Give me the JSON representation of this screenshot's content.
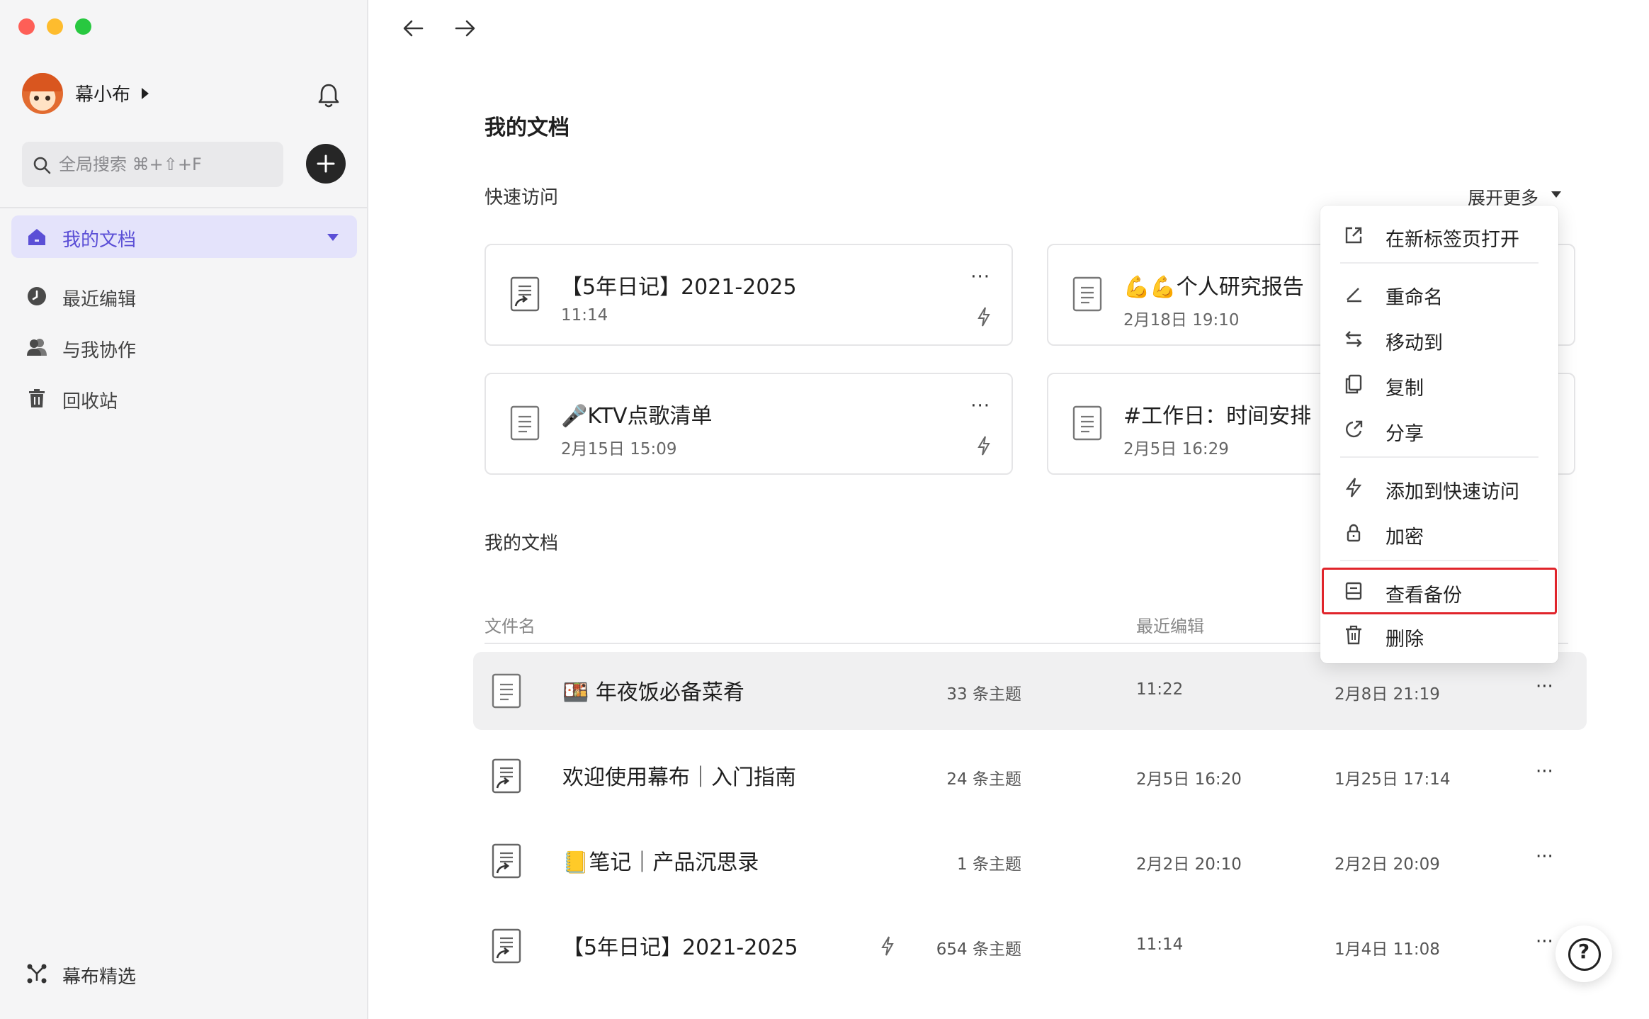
{
  "sidebar": {
    "user_name": "幕小布",
    "search_placeholder": "全局搜索 ⌘+⇧+F",
    "nav": [
      {
        "label": "我的文档",
        "icon": "home-icon",
        "active": true
      },
      {
        "label": "最近编辑",
        "icon": "clock-icon"
      },
      {
        "label": "与我协作",
        "icon": "users-icon"
      },
      {
        "label": "回收站",
        "icon": "trash-icon"
      }
    ],
    "footer_label": "幕布精选"
  },
  "main": {
    "title": "我的文档",
    "quick_access": {
      "label": "快速访问",
      "expand_label": "展开更多",
      "cards": [
        {
          "title": "【5年日记】2021-2025",
          "time": "11:14",
          "icon": "doc-link-icon"
        },
        {
          "title": "💪💪个人研究报告",
          "time": "2月18日 19:10",
          "icon": "doc-icon"
        },
        {
          "title": "🎤KTV点歌清单",
          "time": "2月15日 15:09",
          "icon": "doc-icon"
        },
        {
          "title": "#工作日：时间安排",
          "time": "2月5日 16:29",
          "icon": "doc-icon"
        }
      ]
    },
    "docs": {
      "label": "我的文档",
      "columns": {
        "name": "文件名",
        "edited": "最近编辑"
      },
      "rows": [
        {
          "title": "🍱 年夜饭必备菜肴",
          "count": "33 条主题",
          "edited": "11:22",
          "created": "2月8日 21:19",
          "icon": "doc-icon"
        },
        {
          "title": "欢迎使用幕布｜入门指南",
          "count": "24 条主题",
          "edited": "2月5日 16:20",
          "created": "1月25日 17:14",
          "icon": "doc-link-icon"
        },
        {
          "title": "📒笔记｜产品沉思录",
          "count": "1 条主题",
          "edited": "2月2日 20:10",
          "created": "2月2日 20:09",
          "icon": "doc-link-icon"
        },
        {
          "title": "【5年日记】2021-2025",
          "count": "654 条主题",
          "edited": "11:14",
          "created": "1月4日 11:08",
          "icon": "doc-link-icon"
        }
      ]
    }
  },
  "context_menu": {
    "items": [
      {
        "label": "在新标签页打开",
        "icon": "external-link-icon"
      },
      {
        "label": "重命名",
        "icon": "rename-icon"
      },
      {
        "label": "移动到",
        "icon": "move-icon"
      },
      {
        "label": "复制",
        "icon": "copy-icon"
      },
      {
        "label": "分享",
        "icon": "share-icon"
      },
      {
        "label": "添加到快速访问",
        "icon": "bolt-icon"
      },
      {
        "label": "加密",
        "icon": "lock-icon"
      },
      {
        "label": "查看备份",
        "icon": "backup-icon",
        "highlighted": true
      },
      {
        "label": "删除",
        "icon": "trash-icon"
      }
    ]
  },
  "help_label": "?",
  "colors": {
    "accent": "#5b4fd6",
    "active_bg": "#e4e3fb",
    "highlight_border": "#e0242b"
  }
}
